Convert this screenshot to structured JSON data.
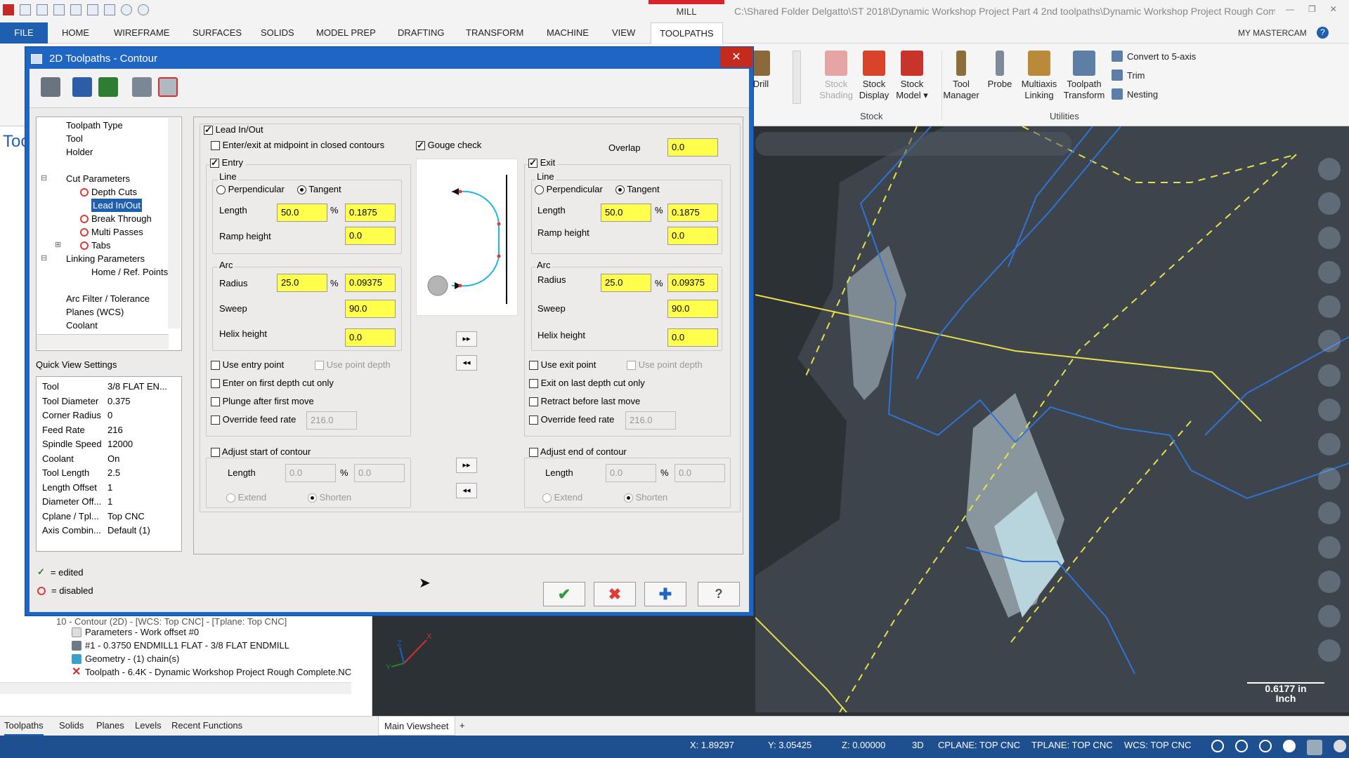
{
  "app": {
    "window_title": "C:\\Shared Folder Delgatto\\ST 2018\\Dynamic Workshop Project Part 4 2nd toolpaths\\Dynamic Workshop Project Rough Complet...",
    "context_tab": "MILL",
    "menu": [
      "FILE",
      "HOME",
      "WIREFRAME",
      "SURFACES",
      "SOLIDS",
      "MODEL PREP",
      "DRAFTING",
      "TRANSFORM",
      "MACHINE",
      "VIEW",
      "TOOLPATHS"
    ],
    "my_mastercam": "MY MASTERCAM",
    "help": "?"
  },
  "ribbon": {
    "drill": "Drill",
    "stock_buttons": [
      {
        "label1": "Stock",
        "label2": "Shading",
        "disabled": true,
        "color": "#e6a5a5"
      },
      {
        "label1": "Stock",
        "label2": "Display",
        "disabled": false,
        "color": "#d8432c"
      },
      {
        "label1": "Stock",
        "label2": "Model ▾",
        "disabled": false,
        "color": "#c9342a"
      }
    ],
    "stock_group": "Stock",
    "util_buttons": [
      {
        "label1": "Tool",
        "label2": "Manager",
        "color": "#8b6e3a"
      },
      {
        "label1": "Probe",
        "label2": "",
        "color": "#7d8a99"
      },
      {
        "label1": "Multiaxis",
        "label2": "Linking",
        "color": "#b88a3a"
      },
      {
        "label1": "Toolpath",
        "label2": "Transform",
        "color": "#5d7fa6"
      }
    ],
    "util_list": [
      "Convert to 5-axis",
      "Trim",
      "Nesting"
    ],
    "utilities_group": "Utilities"
  },
  "dialog": {
    "title": "2D Toolpaths - Contour",
    "close": "✕",
    "tree": [
      {
        "label": "Toolpath Type",
        "indent": 0,
        "icon": "none",
        "selected": false
      },
      {
        "label": "Tool",
        "indent": 0,
        "icon": "none",
        "selected": false
      },
      {
        "label": "Holder",
        "indent": 0,
        "icon": "none",
        "selected": false
      },
      {
        "label": "",
        "indent": 0,
        "icon": "none",
        "selected": false
      },
      {
        "label": "Cut Parameters",
        "indent": 0,
        "icon": "minus",
        "selected": false
      },
      {
        "label": "Depth Cuts",
        "indent": 1,
        "icon": "disabled",
        "selected": false
      },
      {
        "label": "Lead In/Out",
        "indent": 1,
        "icon": "none",
        "selected": true
      },
      {
        "label": "Break Through",
        "indent": 1,
        "icon": "disabled",
        "selected": false
      },
      {
        "label": "Multi Passes",
        "indent": 1,
        "icon": "disabled",
        "selected": false
      },
      {
        "label": "Tabs",
        "indent": 1,
        "icon": "disabled-plus",
        "selected": false
      },
      {
        "label": "Linking Parameters",
        "indent": 0,
        "icon": "minus",
        "selected": false
      },
      {
        "label": "Home / Ref. Points",
        "indent": 1,
        "icon": "none",
        "selected": false
      },
      {
        "label": "",
        "indent": 0,
        "icon": "none",
        "selected": false
      },
      {
        "label": "Arc Filter / Tolerance",
        "indent": 0,
        "icon": "none",
        "selected": false
      },
      {
        "label": "Planes (WCS)",
        "indent": 0,
        "icon": "none",
        "selected": false
      },
      {
        "label": "Coolant",
        "indent": 0,
        "icon": "none",
        "selected": false
      }
    ],
    "quick_view_title": "Quick View Settings",
    "quick_view": [
      {
        "k": "Tool",
        "v": "3/8 FLAT EN..."
      },
      {
        "k": "Tool Diameter",
        "v": "0.375"
      },
      {
        "k": "Corner Radius",
        "v": "0"
      },
      {
        "k": "Feed Rate",
        "v": "216"
      },
      {
        "k": "Spindle Speed",
        "v": "12000"
      },
      {
        "k": "Coolant",
        "v": "On"
      },
      {
        "k": "Tool Length",
        "v": "2.5"
      },
      {
        "k": "Length Offset",
        "v": "1"
      },
      {
        "k": "Diameter Off...",
        "v": "1"
      },
      {
        "k": "Cplane / Tpl...",
        "v": "Top CNC"
      },
      {
        "k": "Axis Combin...",
        "v": "Default (1)"
      }
    ],
    "legend_edited": "= edited",
    "legend_disabled": "= disabled",
    "lead_inout": "Lead In/Out",
    "midpoint": "Enter/exit at midpoint in closed contours",
    "gouge": "Gouge check",
    "overlap_label": "Overlap",
    "overlap": "0.0",
    "entry": {
      "title": "Entry",
      "line": "Line",
      "perpendicular": "Perpendicular",
      "tangent": "Tangent",
      "length_label": "Length",
      "length_pct": "50.0",
      "length_val": "0.1875",
      "ramp_label": "Ramp height",
      "ramp": "0.0",
      "arc": "Arc",
      "radius_label": "Radius",
      "radius_pct": "25.0",
      "radius_val": "0.09375",
      "sweep_label": "Sweep",
      "sweep": "90.0",
      "helix_label": "Helix height",
      "helix": "0.0",
      "use_point": "Use entry point",
      "use_depth": "Use point depth",
      "first_depth": "Enter on first depth cut only",
      "plunge": "Plunge after first move",
      "override": "Override feed rate",
      "feed": "216.0",
      "adjust": "Adjust start of contour",
      "adj_length": "Length",
      "adj_pct": "0.0",
      "adj_val": "0.0",
      "extend": "Extend",
      "shorten": "Shorten"
    },
    "exit": {
      "title": "Exit",
      "line": "Line",
      "perpendicular": "Perpendicular",
      "tangent": "Tangent",
      "length_label": "Length",
      "length_pct": "50.0",
      "length_val": "0.1875",
      "ramp_label": "Ramp height",
      "ramp": "0.0",
      "arc": "Arc",
      "radius_label": "Radius",
      "radius_pct": "25.0",
      "radius_val": "0.09375",
      "sweep_label": "Sweep",
      "sweep": "90.0",
      "helix_label": "Helix height",
      "helix": "0.0",
      "use_point": "Use exit point",
      "use_depth": "Use point depth",
      "last_depth": "Exit on last depth cut only",
      "retract": "Retract before last move",
      "override": "Override feed rate",
      "feed": "216.0",
      "adjust": "Adjust end of contour",
      "adj_length": "Length",
      "adj_pct": "0.0",
      "adj_val": "0.0",
      "extend": "Extend",
      "shorten": "Shorten"
    },
    "pct": "%",
    "copy_right": "▸▸",
    "copy_left": "◂◂",
    "ok": "✔",
    "cancel": "✖",
    "apply": "✚",
    "help": "?"
  },
  "left_panel": {
    "tool_text": "Too",
    "tree_top": "10 - Contour (2D) - [WCS: Top CNC] - [Tplane: Top CNC]",
    "tree": [
      "Parameters - Work offset #0",
      "#1 - 0.3750 ENDMILL1 FLAT - 3/8 FLAT ENDMILL",
      "Geometry - (1) chain(s)",
      "Toolpath - 6.4K - Dynamic Workshop Project Rough Complete.NC"
    ]
  },
  "axis": {
    "x": "X",
    "y": "Y",
    "z": "Z"
  },
  "scale": {
    "value": "0.6177 in",
    "unit": "Inch"
  },
  "bottom_tabs": [
    "Toolpaths",
    "Solids",
    "Planes",
    "Levels",
    "Recent Functions"
  ],
  "viewsheet": "Main Viewsheet",
  "viewsheet_add": "+",
  "status": {
    "x_label": "X:",
    "x": "1.89297",
    "y_label": "Y:",
    "y": "3.05425",
    "z_label": "Z:",
    "z": "0.00000",
    "mode": "3D",
    "cplane": "CPLANE: TOP CNC",
    "tplane": "TPLANE: TOP CNC",
    "wcs": "WCS: TOP CNC"
  }
}
